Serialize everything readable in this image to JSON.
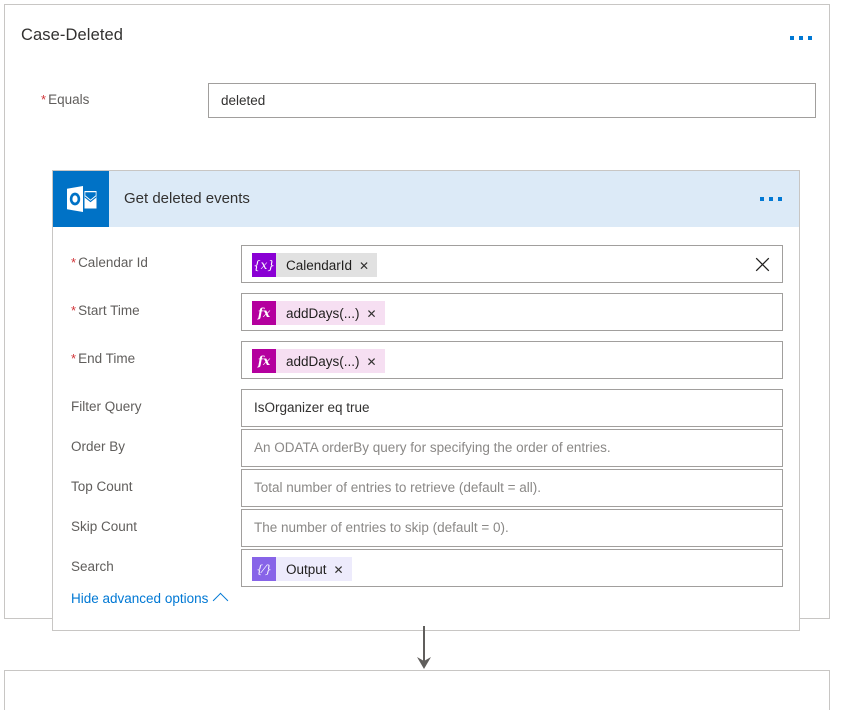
{
  "panel": {
    "title": "Case-Deleted",
    "menu_icon": "ellipsis-icon"
  },
  "equals_row": {
    "label": "Equals",
    "required": true,
    "value": "deleted"
  },
  "card": {
    "title": "Get deleted events",
    "app_icon": "outlook-icon",
    "menu_icon": "ellipsis-icon",
    "header_color": "#dceaf7",
    "icon_color": "#0072c6",
    "rows": [
      {
        "label": "Calendar Id",
        "required": true,
        "kind": "token",
        "token": {
          "glyph": "{x}",
          "text": "CalendarId",
          "style": "var",
          "glyph_color": "#8a00d4",
          "chip_color": "#e1e1e1"
        },
        "has_clear": true,
        "clear_icon": "close-icon"
      },
      {
        "label": "Start Time",
        "required": true,
        "kind": "token",
        "token": {
          "glyph": "fx",
          "text": "addDays(...)",
          "style": "fx",
          "glyph_color": "#b4009e",
          "chip_color": "#f6dff2"
        },
        "has_clear": false
      },
      {
        "label": "End Time",
        "required": true,
        "kind": "token",
        "token": {
          "glyph": "fx",
          "text": "addDays(...)",
          "style": "fx",
          "glyph_color": "#b4009e",
          "chip_color": "#f6dff2"
        },
        "has_clear": false
      },
      {
        "label": "Filter Query",
        "required": false,
        "kind": "text",
        "value": "IsOrganizer eq true",
        "placeholder": ""
      },
      {
        "label": "Order By",
        "required": false,
        "kind": "text",
        "value": "",
        "placeholder": "An ODATA orderBy query for specifying the order of entries."
      },
      {
        "label": "Top Count",
        "required": false,
        "kind": "text",
        "value": "",
        "placeholder": "Total number of entries to retrieve (default = all)."
      },
      {
        "label": "Skip Count",
        "required": false,
        "kind": "text",
        "value": "",
        "placeholder": "The number of entries to skip (default = 0)."
      },
      {
        "label": "Search",
        "required": false,
        "kind": "token",
        "token": {
          "glyph": "{⁄}",
          "text": "Output",
          "style": "expr",
          "glyph_color": "#8764e8",
          "chip_color": "#edebfc"
        },
        "has_clear": false
      }
    ],
    "advanced_link": {
      "label": "Hide advanced options",
      "icon": "chevron-up-icon"
    }
  },
  "connector": {
    "arrow_icon": "arrow-down-icon",
    "color": "#605e5c"
  },
  "theme": {
    "accent": "#0078d4",
    "required_star": "#d13438",
    "border": "#a19f9d",
    "panel_border": "#c8c6c4",
    "label_text": "#605e5c",
    "value_text": "#323130",
    "placeholder_text": "#8a8886"
  }
}
